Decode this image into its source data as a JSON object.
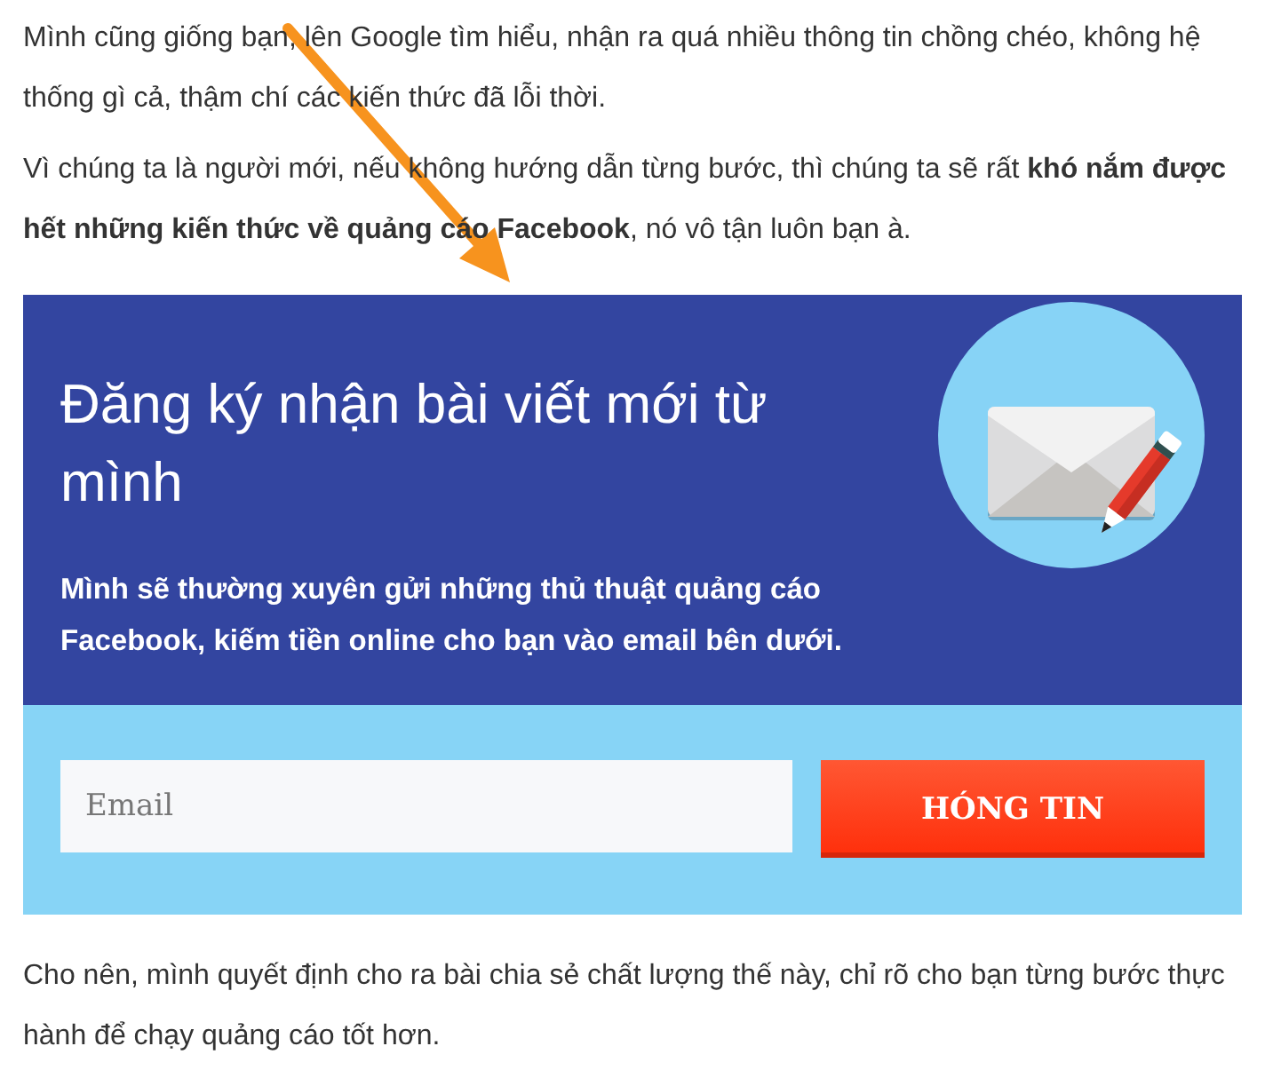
{
  "paragraphs_top": [
    "Mình cũng giống bạn, lên Google tìm hiểu, nhận ra quá nhiều thông tin chồng chéo, không hệ thống gì cả, thậm chí các kiến thức đã lỗi thời.",
    "Vì chúng ta là người mới, nếu không hướng dẫn từng bước, thì chúng ta sẽ rất **khó nắm được hết những kiến thức về quảng cáo Facebook**, nó vô tận luôn bạn à."
  ],
  "signup_box": {
    "title": "Đăng ký nhận bài viết mới từ mình",
    "description": "Mình sẽ thường xuyên gửi những thủ thuật quảng cáo Facebook, kiếm tiền online cho bạn vào email bên dưới.",
    "email_field": {
      "placeholder": "Email"
    },
    "submit_button": "HÓNG TIN"
  },
  "paragraphs_bottom": [
    "Cho nên, mình quyết định cho ra bài chia sẻ chất lượng thế này, chỉ rõ cho bạn từng bước thực hành để chạy quảng cáo tốt hơn."
  ]
}
